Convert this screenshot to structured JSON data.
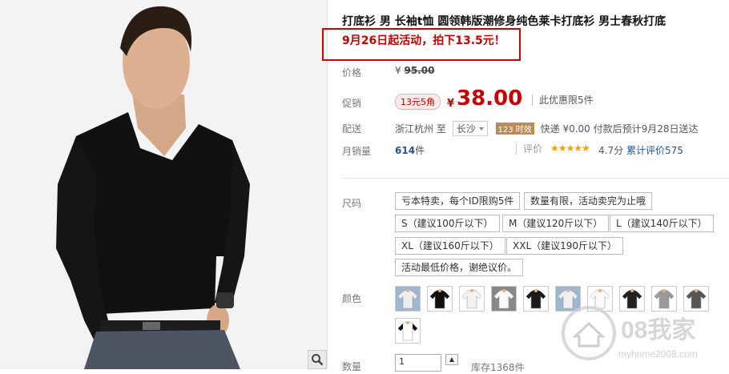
{
  "product": {
    "title": "打底衫 男 长袖t恤 圆领韩版潮修身纯色莱卡打底衫 男士春秋打底",
    "promo": "9月26日起活动，拍下13.5元！"
  },
  "labels": {
    "price": "价格",
    "promo": "促销",
    "ship": "配送",
    "sales": "月销量",
    "size": "尺码",
    "color": "颜色",
    "qty": "数量"
  },
  "price": {
    "currency": "¥",
    "original": "95.00",
    "badge": "13元5角",
    "current": "38.00",
    "limit": "此优惠限5件"
  },
  "shipping": {
    "from": "浙江杭州",
    "to_word": "至",
    "city": "长沙",
    "days": "123 时效",
    "express": "快递 ¥0.00",
    "pay_date": "付款后预计9月28日送达"
  },
  "sales": {
    "count": "614",
    "unit": "件",
    "review_label": "评价",
    "stars": "★★★★★",
    "score": "4.7分",
    "cum_label": "累计评价",
    "cum_count": "575"
  },
  "sizes": [
    "亏本特卖，每个ID限购5件",
    "数量有限，活动卖完为止哦",
    "S（建议100斤以下）",
    "M（建议120斤以下）",
    "L（建议140斤以下）",
    "XL（建议160斤以下）",
    "XXL（建议190斤以下）",
    "活动最低价格，谢绝议价。"
  ],
  "colors": {
    "swatches": [
      {
        "shirt": "#eeeeee",
        "bg": "#9fb6cf"
      },
      {
        "shirt": "#111111",
        "bg": "#ffffff"
      },
      {
        "shirt": "#f2f2f2",
        "bg": "#ffffff"
      },
      {
        "shirt": "#f8f8f8",
        "bg": "#888888"
      },
      {
        "shirt": "#1a1a1a",
        "bg": "#ffffff"
      },
      {
        "shirt": "#efefef",
        "bg": "#9fb6cf"
      },
      {
        "shirt": "#fafafa",
        "bg": "#ffffff"
      },
      {
        "shirt": "#222222",
        "bg": "#ffffff"
      },
      {
        "shirt": "#9a9a9a",
        "bg": "#ffffff"
      },
      {
        "shirt": "#555555",
        "bg": "#ffffff"
      },
      {
        "shirt": "#ffffff",
        "bg": "#ffffff"
      }
    ]
  },
  "quantity": {
    "value": "1",
    "stock": "库存1368件"
  },
  "watermark": {
    "brand": "08我家",
    "url": "myhome2008.com"
  },
  "icons": {
    "zoom": "magnifier-icon",
    "dropdown": "chevron-down-icon",
    "spinner": "up-arrow-icon"
  },
  "colors_theme": {
    "accent_red": "#c40000",
    "link_blue": "#225592",
    "star_orange": "#f0a000"
  }
}
